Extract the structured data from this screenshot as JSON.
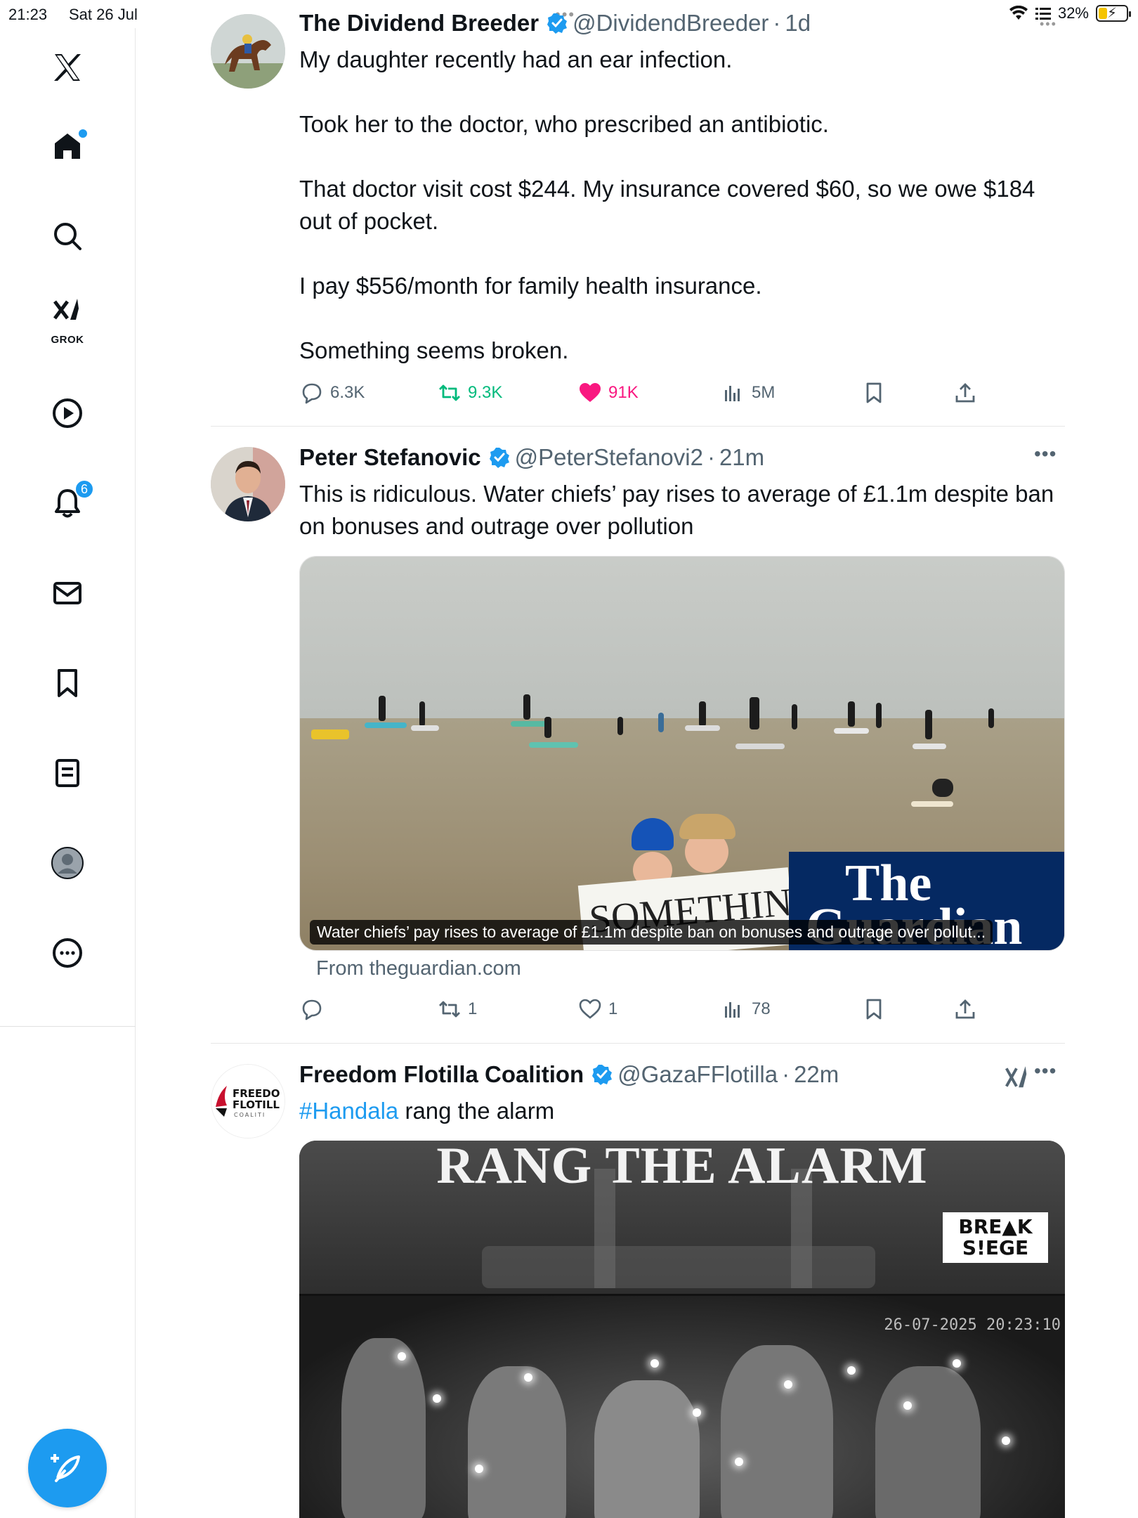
{
  "status_bar": {
    "time": "21:23",
    "date": "Sat 26 Jul",
    "battery": "32%",
    "battery_level": 0.32
  },
  "sidebar": {
    "items": [
      {
        "name": "x-logo",
        "label": ""
      },
      {
        "name": "home",
        "label": ""
      },
      {
        "name": "search",
        "label": ""
      },
      {
        "name": "grok",
        "label": "GROK"
      },
      {
        "name": "videos",
        "label": ""
      },
      {
        "name": "notifications",
        "label": "",
        "badge": "6"
      },
      {
        "name": "messages",
        "label": ""
      },
      {
        "name": "bookmarks",
        "label": ""
      },
      {
        "name": "lists",
        "label": ""
      },
      {
        "name": "profile",
        "label": ""
      },
      {
        "name": "more",
        "label": ""
      }
    ]
  },
  "tweets": [
    {
      "name": "The Dividend Breeder",
      "handle": "@DividendBreeder",
      "dot": "·",
      "time": "1d",
      "paragraphs": [
        "My daughter recently had an ear infection.",
        "Took her to the doctor, who prescribed an antibiotic.",
        "That doctor visit cost $244. My insurance covered $60, so we owe $184 out of pocket.",
        "I pay $556/month for family health insurance.",
        "Something seems broken."
      ],
      "stats": {
        "replies": "6.3K",
        "reposts": "9.3K",
        "likes": "91K",
        "views": "5M"
      }
    },
    {
      "name": "Peter Stefanovic",
      "handle": "@PeterStefanovi2",
      "dot": "·",
      "time": "21m",
      "text": "This is ridiculous. Water chiefs’ pay rises to average of £1.1m despite ban on bonuses and outrage over pollution",
      "card": {
        "caption": "Water chiefs’ pay rises to average of £1.1m despite ban on bonuses and outrage over pollut...",
        "source": "From theguardian.com",
        "image_logo_line1": "The",
        "image_logo_line2": "Guardian",
        "image_sign": "SOMETHING..."
      },
      "stats": {
        "replies": "",
        "reposts": "1",
        "likes": "1",
        "views": "78"
      }
    },
    {
      "name": "Freedom Flotilla Coalition",
      "handle": "@GazaFFlotilla",
      "dot": "·",
      "time": "22m",
      "hashtag": "#Handala",
      "text_rest": " rang the alarm",
      "video": {
        "headline": "RANG THE ALARM",
        "logo_line1": "BRE▲K",
        "logo_line2": "S!EGE",
        "timestamp": "26-07-2025 20:23:10"
      }
    }
  ],
  "colors": {
    "accent": "#1d9bf0",
    "repost_green": "#00ba7c",
    "like_pink": "#f91880",
    "muted": "#536471",
    "guardian_blue": "#052962"
  }
}
